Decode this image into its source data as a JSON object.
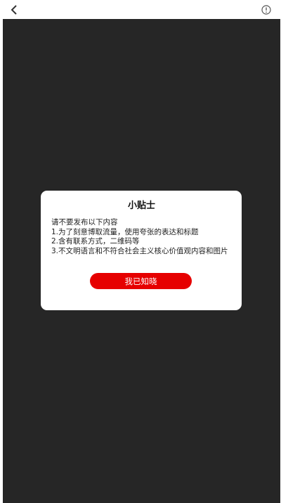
{
  "header": {
    "back_icon": "chevron-left-icon",
    "info_icon": "info-circle-icon"
  },
  "modal": {
    "title": "小贴士",
    "lines": [
      "请不要发布以下内容",
      "1.为了刻意博取流量，使用夸张的表达和标题",
      "2.含有联系方式，二维码等",
      "3.不文明语言和不符合社会主义核心价值观内容和图片"
    ],
    "confirm_label": "我已知晓"
  },
  "colors": {
    "overlay": "#262626",
    "accent": "#e60000"
  }
}
